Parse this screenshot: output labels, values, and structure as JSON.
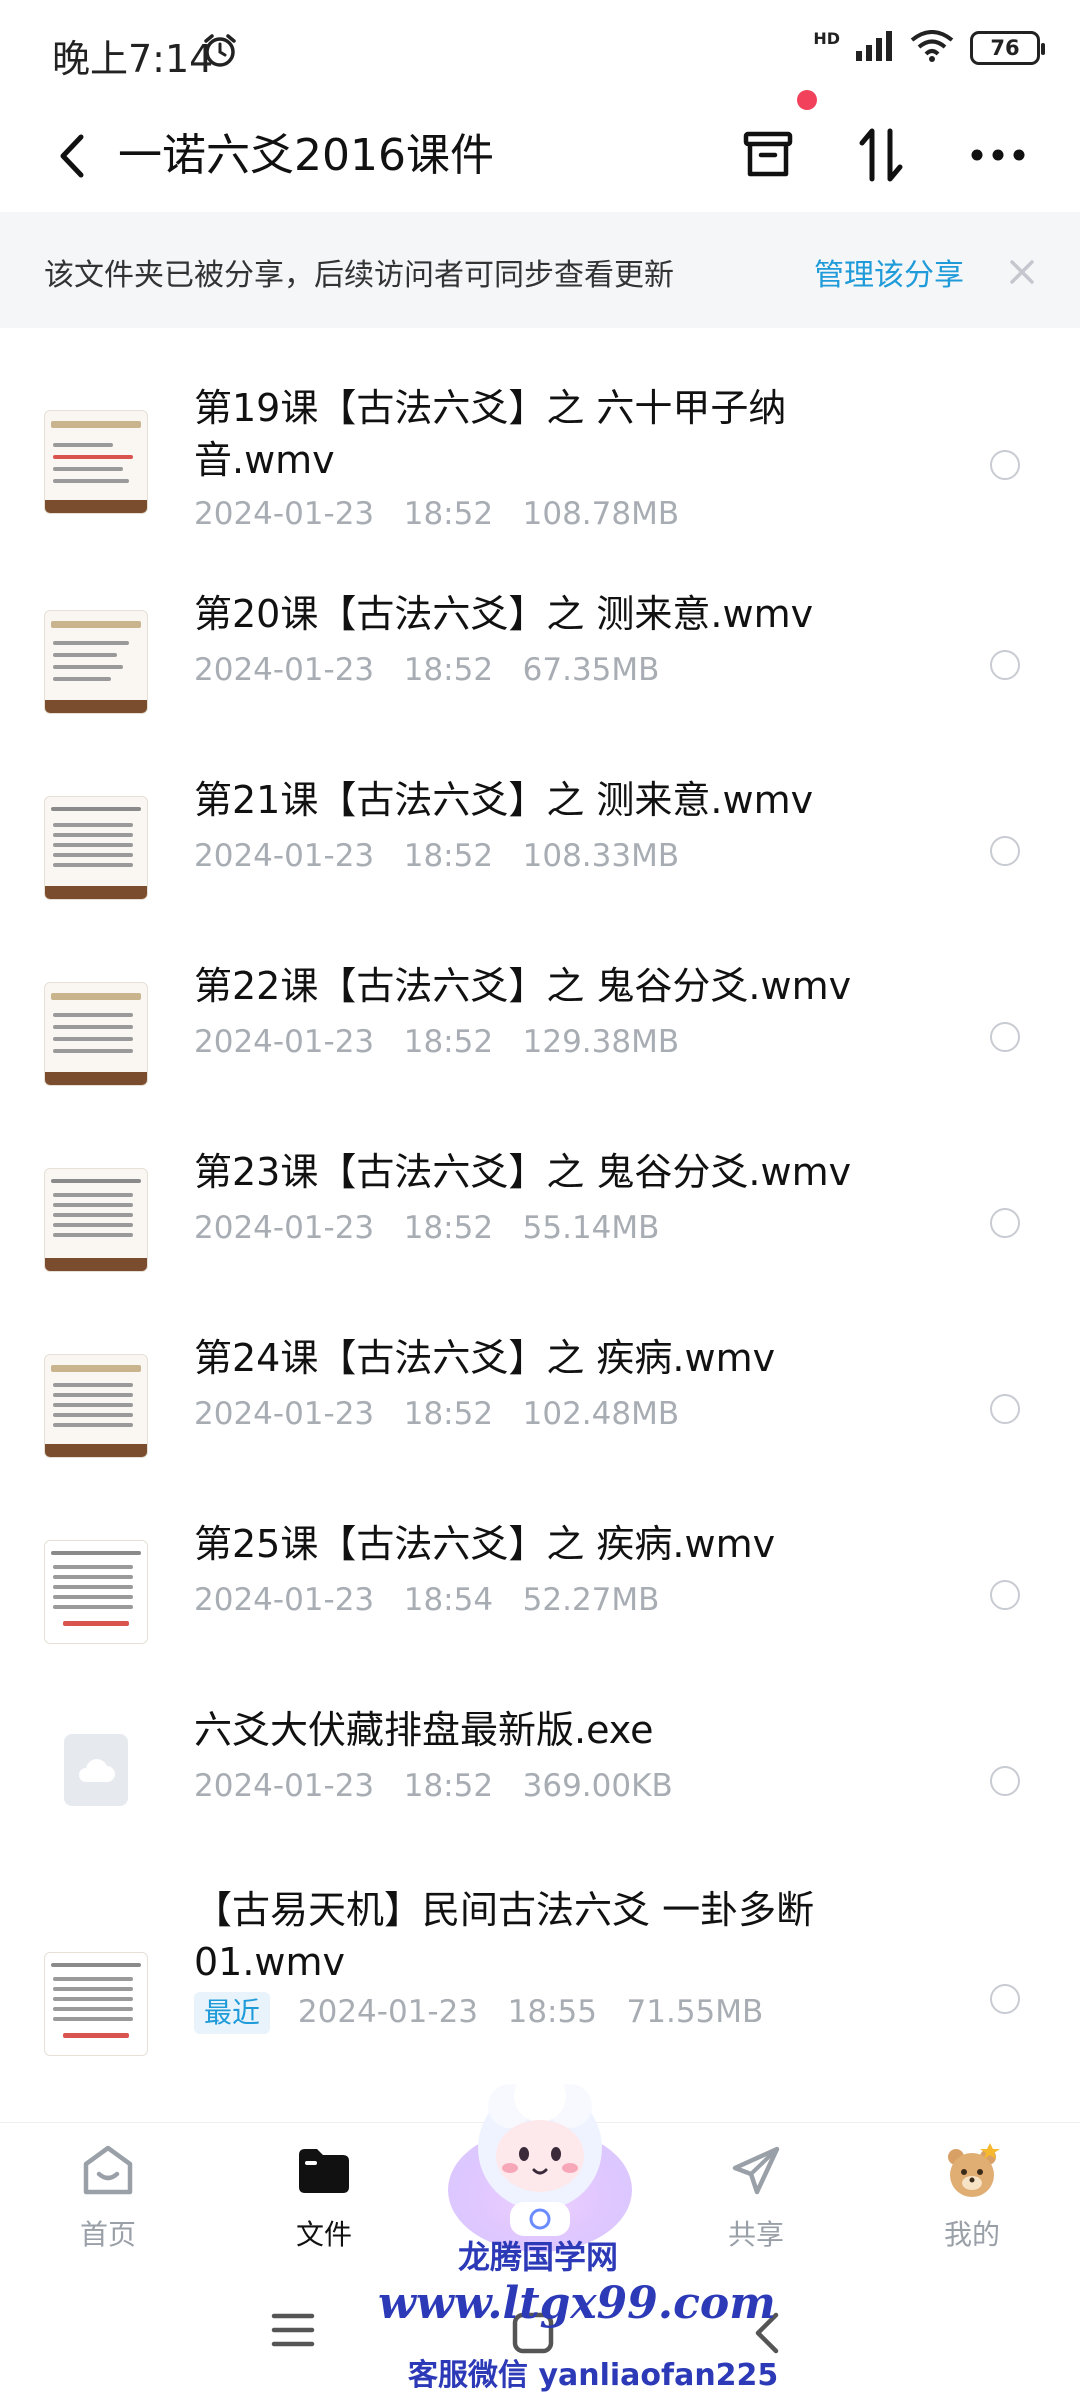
{
  "status_bar": {
    "time": "晚上7:14",
    "network_label": "HD",
    "battery": "76"
  },
  "header": {
    "title": "一诺六爻2016课件"
  },
  "share_banner": {
    "text": "该文件夹已被分享，后续访问者可同步查看更新",
    "manage_label": "管理该分享"
  },
  "files": [
    {
      "name": "第19课【古法六爻】之 六十甲子纳音.wmv",
      "date": "2024-01-23",
      "time": "18:52",
      "size": "108.78MB",
      "icon": "video-thumbnail"
    },
    {
      "name": "第20课【古法六爻】之 测来意.wmv",
      "date": "2024-01-23",
      "time": "18:52",
      "size": "67.35MB",
      "icon": "video-thumbnail"
    },
    {
      "name": "第21课【古法六爻】之 测来意.wmv",
      "date": "2024-01-23",
      "time": "18:52",
      "size": "108.33MB",
      "icon": "video-thumbnail"
    },
    {
      "name": "第22课【古法六爻】之 鬼谷分爻.wmv",
      "date": "2024-01-23",
      "time": "18:52",
      "size": "129.38MB",
      "icon": "video-thumbnail"
    },
    {
      "name": "第23课【古法六爻】之 鬼谷分爻.wmv",
      "date": "2024-01-23",
      "time": "18:52",
      "size": "55.14MB",
      "icon": "video-thumbnail"
    },
    {
      "name": "第24课【古法六爻】之 疾病.wmv",
      "date": "2024-01-23",
      "time": "18:52",
      "size": "102.48MB",
      "icon": "video-thumbnail"
    },
    {
      "name": "第25课【古法六爻】之 疾病.wmv",
      "date": "2024-01-23",
      "time": "18:54",
      "size": "52.27MB",
      "icon": "video-thumbnail"
    },
    {
      "name": "六爻大伏藏排盘最新版.exe",
      "date": "2024-01-23",
      "time": "18:52",
      "size": "369.00KB",
      "icon": "cloud-file-icon"
    },
    {
      "name": "【古易天机】民间古法六爻  一卦多断01.wmv",
      "date": "2024-01-23",
      "time": "18:55",
      "size": "71.55MB",
      "icon": "video-thumbnail",
      "badge": "最近"
    }
  ],
  "tabs": [
    {
      "label": "首页",
      "icon": "home-icon",
      "active": false
    },
    {
      "label": "文件",
      "icon": "folder-icon",
      "active": true
    },
    {
      "label": "共享",
      "icon": "send-icon",
      "active": false
    },
    {
      "label": "我的",
      "icon": "bear-avatar-icon",
      "active": false
    }
  ],
  "watermark": {
    "name": "龙腾国学网",
    "url": "www.ltgx99.com",
    "contact": "客服微信 yanliaofan225"
  },
  "colors": {
    "accent": "#1e9bd8",
    "badge_dot": "#f2415b",
    "watermark": "#2d3ab8"
  }
}
